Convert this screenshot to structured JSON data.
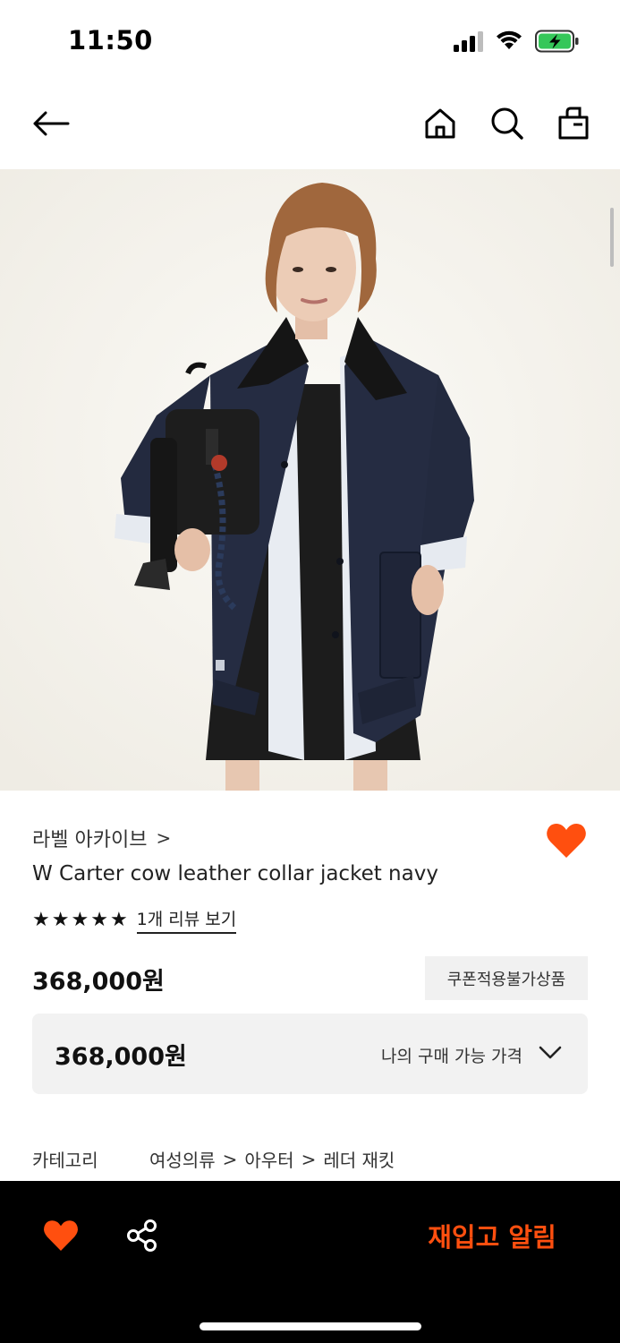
{
  "status_bar": {
    "time": "11:50",
    "icons": [
      "signal-icon",
      "wifi-icon",
      "battery-charging-icon"
    ]
  },
  "nav": {
    "icons": [
      "back-arrow-icon",
      "home-icon",
      "search-icon",
      "shopping-bag-icon"
    ]
  },
  "product": {
    "image_alt": "product-photo",
    "brand": "라벨 아카이브",
    "brand_chevron": ">",
    "title": "W Carter cow leather collar jacket navy",
    "rating_stars": 5,
    "review_link": "1개 리뷰 보기",
    "price": "368,000원",
    "coupon_badge": "쿠폰적용불가상품",
    "my_price_value": "368,000원",
    "my_price_label": "나의 구매 가능 가격",
    "category_label": "카테고리",
    "categories": [
      "여성의류",
      "아우터",
      "레더 재킷"
    ],
    "category_separator": ">"
  },
  "bottom_bar": {
    "restock_label": "재입고 알림",
    "accent_color": "#ff4f0f"
  },
  "colors": {
    "heart": "#ff4f0f",
    "bottom_bar_bg": "#000000"
  }
}
